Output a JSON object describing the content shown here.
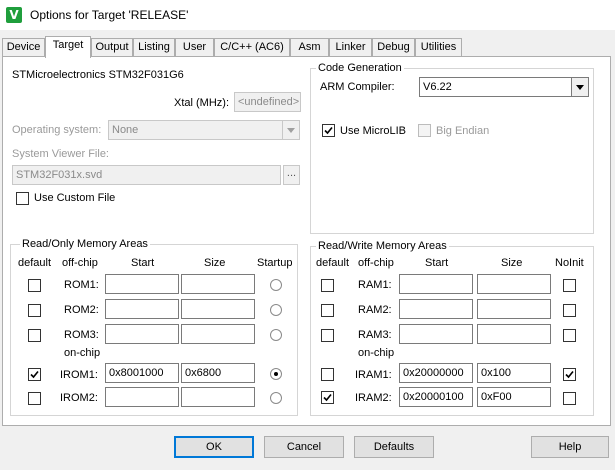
{
  "window": {
    "title": "Options for Target 'RELEASE'",
    "icon": "V"
  },
  "tabs": [
    "Device",
    "Target",
    "Output",
    "Listing",
    "User",
    "C/C++ (AC6)",
    "Asm",
    "Linker",
    "Debug",
    "Utilities"
  ],
  "device": {
    "name": "STMicroelectronics STM32F031G6",
    "xtal_label": "Xtal (MHz):",
    "xtal_value": "<undefined>",
    "os_label": "Operating system:",
    "os_value": "None",
    "svd_label": "System Viewer File:",
    "svd_value": "STM32F031x.svd",
    "svd_browse": "...",
    "custom_file_label": "Use Custom File",
    "custom_file_checked": false
  },
  "code_generation": {
    "title": "Code Generation",
    "compiler_label": "ARM Compiler:",
    "compiler_value": "V6.22",
    "microlib_label": "Use MicroLIB",
    "microlib_checked": true,
    "big_endian_label": "Big Endian",
    "big_endian_checked": false
  },
  "ro_memory": {
    "title": "Read/Only Memory Areas",
    "headers": {
      "default": "default",
      "offchip": "off-chip",
      "start": "Start",
      "size": "Size",
      "startup": "Startup"
    },
    "onchip_label": "on-chip",
    "rows": [
      {
        "name": "ROM1:",
        "start": "",
        "size": "",
        "default": false,
        "startup": false
      },
      {
        "name": "ROM2:",
        "start": "",
        "size": "",
        "default": false,
        "startup": false
      },
      {
        "name": "ROM3:",
        "start": "",
        "size": "",
        "default": false,
        "startup": false
      },
      {
        "name": "IROM1:",
        "start": "0x8001000",
        "size": "0x6800",
        "default": true,
        "startup": true
      },
      {
        "name": "IROM2:",
        "start": "",
        "size": "",
        "default": false,
        "startup": false
      }
    ]
  },
  "rw_memory": {
    "title": "Read/Write Memory Areas",
    "headers": {
      "default": "default",
      "offchip": "off-chip",
      "start": "Start",
      "size": "Size",
      "noinit": "NoInit"
    },
    "onchip_label": "on-chip",
    "rows": [
      {
        "name": "RAM1:",
        "start": "",
        "size": "",
        "default": false,
        "noinit": false
      },
      {
        "name": "RAM2:",
        "start": "",
        "size": "",
        "default": false,
        "noinit": false
      },
      {
        "name": "RAM3:",
        "start": "",
        "size": "",
        "default": false,
        "noinit": false
      },
      {
        "name": "IRAM1:",
        "start": "0x20000000",
        "size": "0x100",
        "default": false,
        "noinit": true
      },
      {
        "name": "IRAM2:",
        "start": "0x20000100",
        "size": "0xF00",
        "default": true,
        "noinit": false
      }
    ]
  },
  "buttons": {
    "ok": "OK",
    "cancel": "Cancel",
    "defaults": "Defaults",
    "help": "Help"
  }
}
